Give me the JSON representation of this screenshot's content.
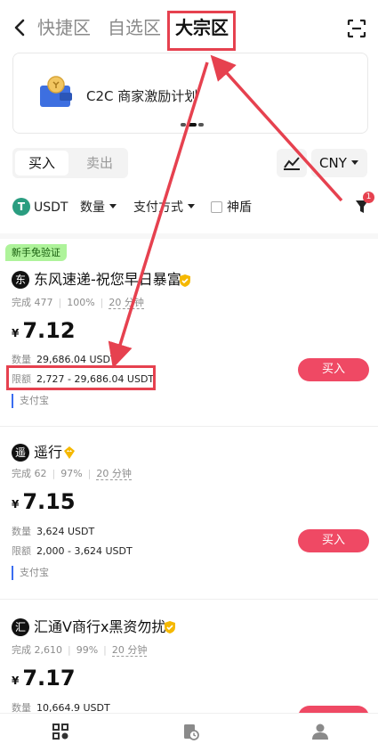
{
  "header": {
    "tabs": [
      {
        "label": "快捷区",
        "active": false
      },
      {
        "label": "自选区",
        "active": false
      },
      {
        "label": "大宗区",
        "active": true
      }
    ]
  },
  "banner": {
    "text": "C2C 商家激励计划"
  },
  "trade_toggle": {
    "buy_label": "买入",
    "sell_label": "卖出",
    "currency": "CNY"
  },
  "filters": {
    "coin": "USDT",
    "coin_icon_glyph": "T",
    "amount": "数量",
    "payment": "支付方式",
    "shield": "神盾",
    "filter_badge": "1"
  },
  "merchants": [
    {
      "newbie_tag": "新手免验证",
      "avatar": "东",
      "name": "东风速递-祝您早日暴富",
      "completed": "完成 477",
      "rate": "100%",
      "time": "20 分钟",
      "currency_symbol": "¥",
      "price": "7.12",
      "quantity_label": "数量",
      "quantity": "29,686.04 USDT",
      "limit_label": "限额",
      "limit": "2,727 - 29,686.04 USDT",
      "payment": "支付宝",
      "buy_label": "买入"
    },
    {
      "avatar": "遥",
      "name": "遥行",
      "completed": "完成 62",
      "rate": "97%",
      "time": "20 分钟",
      "currency_symbol": "¥",
      "price": "7.15",
      "quantity_label": "数量",
      "quantity": "3,624 USDT",
      "limit_label": "限额",
      "limit": "2,000 - 3,624 USDT",
      "payment": "支付宝",
      "buy_label": "买入"
    },
    {
      "avatar": "汇",
      "name": "汇通V商行x黑资勿扰",
      "completed": "完成 2,610",
      "rate": "99%",
      "time": "20 分钟",
      "currency_symbol": "¥",
      "price": "7.17",
      "quantity_label": "数量",
      "quantity": "10,664.9 USDT"
    }
  ],
  "colors": {
    "accent_red": "#ef4964",
    "annotation_red": "#e6414f",
    "newbie_green": "#aef39a",
    "gold": "#f5b800"
  }
}
